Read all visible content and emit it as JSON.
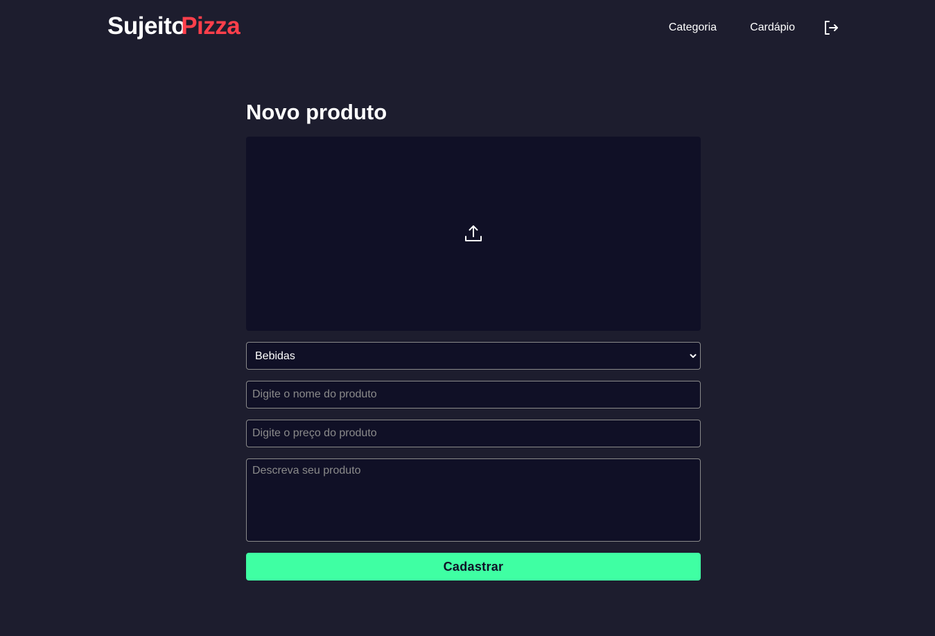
{
  "header": {
    "logo_part1": "Sujeito",
    "logo_part2": "Pizza",
    "nav": {
      "categoria": "Categoria",
      "cardapio": "Cardápio"
    },
    "logout_icon": "logout-icon"
  },
  "form": {
    "title": "Novo produto",
    "upload_icon": "upload-icon",
    "category_selected": "Bebidas",
    "name_placeholder": "Digite o nome do produto",
    "price_placeholder": "Digite o preço do produto",
    "description_placeholder": "Descreva seu produto",
    "submit_label": "Cadastrar"
  },
  "colors": {
    "background": "#1d1d2e",
    "surface": "#101026",
    "accent_red": "#ff3f4b",
    "accent_green": "#3fffa3",
    "border": "#8a8a8a"
  }
}
